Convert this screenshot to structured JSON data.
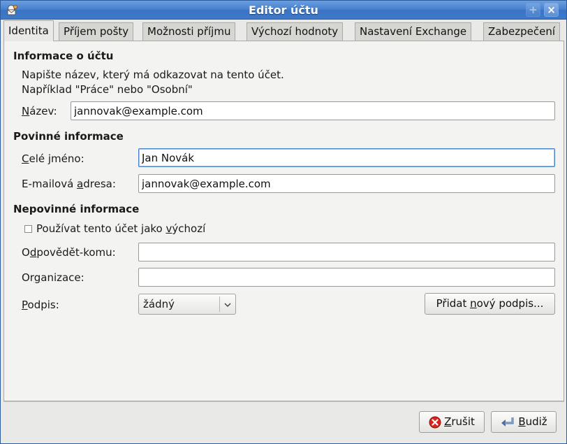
{
  "window": {
    "title": "Editor účtu",
    "controls": {
      "minimize": "+",
      "close": "×"
    }
  },
  "tabs": [
    {
      "label": "Identita",
      "active": true
    },
    {
      "label": "Příjem pošty",
      "active": false
    },
    {
      "label": "Možnosti příjmu",
      "active": false
    },
    {
      "label": "Výchozí hodnoty",
      "active": false
    },
    {
      "label": "Nastavení Exchange",
      "active": false
    },
    {
      "label": "Zabezpečení",
      "active": false
    }
  ],
  "account_info": {
    "heading": "Informace o účtu",
    "hint_line1": "Napište název, který má odkazovat na tento účet.",
    "hint_line2": "Například \"Práce\" nebo \"Osobní\"",
    "name_label_u": "N",
    "name_label_rest": "ázev:",
    "name_value": "jannovak@example.com"
  },
  "required_info": {
    "heading": "Povinné informace",
    "fullname_label_u": "C",
    "fullname_label_rest": "elé jméno:",
    "fullname_value": "Jan Novák",
    "email_label_pre": "E-mailová ",
    "email_label_u": "a",
    "email_label_rest": "dresa:",
    "email_value": "jannovak@example.com"
  },
  "optional_info": {
    "heading": "Nepovinné informace",
    "default_checkbox_pre": "Používat tento účet jako ",
    "default_checkbox_u": "v",
    "default_checkbox_rest": "ýchozí",
    "default_checked": false,
    "reply_to_label_pre": "O",
    "reply_to_label_u": "d",
    "reply_to_label_rest": "povědět-komu:",
    "reply_to_value": "",
    "org_label_pre": "Or",
    "org_label_u": "g",
    "org_label_rest": "anizace:",
    "org_value": "",
    "signature_label_u": "P",
    "signature_label_rest": "odpis:",
    "signature_selected": "žádný",
    "add_signature_pre": "Přidat ",
    "add_signature_u": "n",
    "add_signature_rest": "ový podpis..."
  },
  "footer": {
    "cancel_u": "Z",
    "cancel_rest": "rušit",
    "ok_u": "B",
    "ok_rest": "udiž"
  },
  "icons": {
    "app": "mail-account-icon",
    "cancel": "cancel-icon",
    "ok": "enter-arrow-icon",
    "dropdown": "chevron-down-icon"
  },
  "colors": {
    "titlebar": "#4a82cf",
    "focus_border": "#4b84c9",
    "cancel_icon": "#d9251c"
  }
}
